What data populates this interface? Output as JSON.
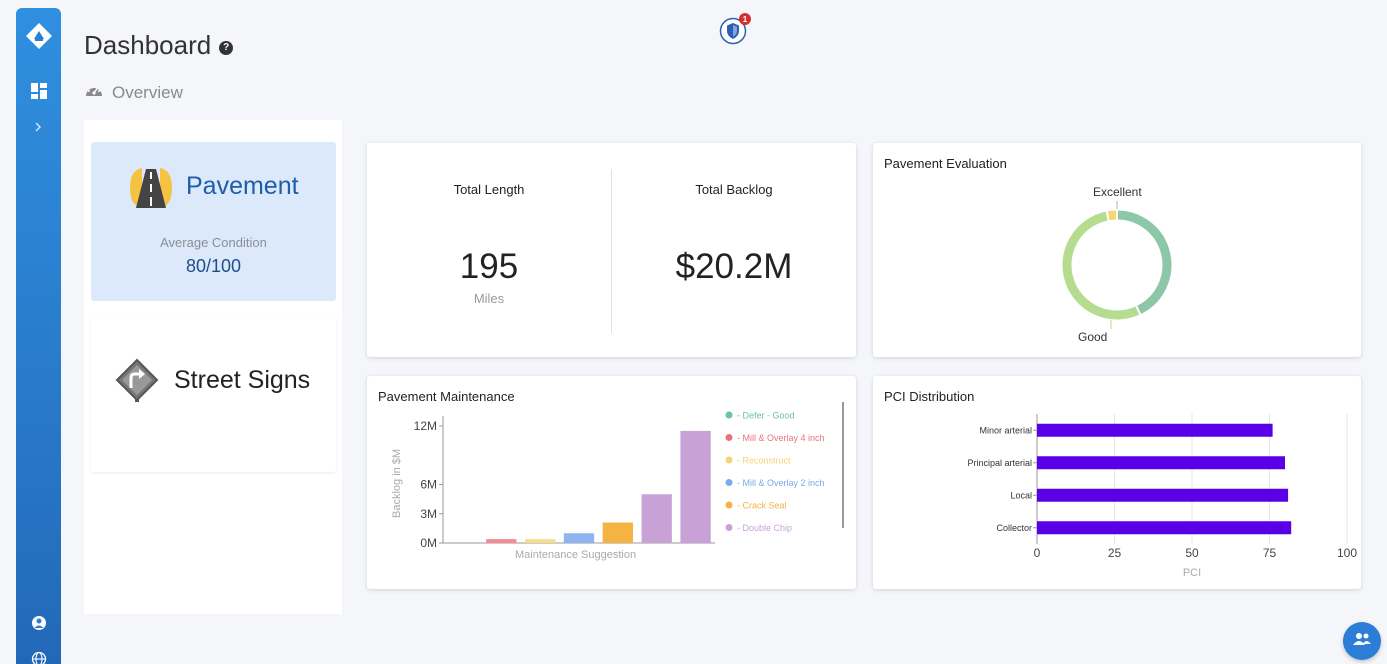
{
  "header": {
    "title": "Dashboard",
    "help_icon": "question-circle-icon",
    "section": "Overview",
    "notification_count": "1"
  },
  "sidebar": {
    "items": [
      {
        "icon": "dashboard-icon"
      },
      {
        "icon": "expand-chevrons-icon"
      },
      {
        "icon": "user-icon"
      },
      {
        "icon": "globe-icon"
      }
    ]
  },
  "assets": [
    {
      "name": "Pavement",
      "icon": "road-icon",
      "condition_label": "Average Condition",
      "condition_value": "80/100",
      "selected": true
    },
    {
      "name": "Street Signs",
      "icon": "street-sign-icon"
    }
  ],
  "stats": {
    "total_length_label": "Total Length",
    "total_length_value": "195",
    "total_length_unit": "Miles",
    "total_backlog_label": "Total Backlog",
    "total_backlog_value": "$20.2M"
  },
  "colors": {
    "sidebar": "#2a7fd4",
    "pavement_card": "#dbe9fa",
    "pci_bar": "#5a00e8",
    "excellent": "#8cc7a8",
    "good": "#b6dc8f",
    "fair": "#f4d870"
  },
  "chart_data": [
    {
      "type": "pie",
      "title": "Pavement Evaluation",
      "labels": [
        "Excellent",
        "Good"
      ],
      "values": [
        43,
        54,
        3
      ],
      "colors": [
        "#8cc7a8",
        "#b6dc8f",
        "#f4d870"
      ]
    },
    {
      "type": "bar",
      "title": "Pavement Maintenance",
      "xlabel": "Maintenance Suggestion",
      "ylabel": "Backlog in $M",
      "ylim": [
        0,
        12
      ],
      "yticks": [
        "0M",
        "3M",
        "6M",
        "12M"
      ],
      "ytick_values": [
        0,
        3,
        6,
        12
      ],
      "legend": [
        "Defer - Good",
        "Mill & Overlay 4 inch",
        "Reconstruct",
        "Mill & Overlay 2 inch",
        "Crack Seal",
        "Double Chip"
      ],
      "legend_colors": [
        "#6cc3a0",
        "#e8737f",
        "#f3d27a",
        "#7aa9ee",
        "#f5b342",
        "#c8a2d6"
      ],
      "values": [
        0,
        0.4,
        0.4,
        1.0,
        2.1,
        5.0,
        11.5
      ],
      "bar_colors": [
        "#6cc3a0",
        "#f28b93",
        "#f7dc8c",
        "#8fb4f0",
        "#f5b342",
        "#c8a2d6",
        "#c8a2d6"
      ]
    },
    {
      "type": "bar",
      "orientation": "horizontal",
      "title": "PCI Distribution",
      "categories": [
        "Minor arterial",
        "Principal arterial",
        "Local",
        "Collector"
      ],
      "values": [
        76,
        80,
        81,
        82
      ],
      "xlabel": "PCI",
      "xlim": [
        0,
        100
      ],
      "xticks": [
        "0",
        "25",
        "50",
        "75",
        "100"
      ],
      "color": "#5a00e8"
    }
  ]
}
